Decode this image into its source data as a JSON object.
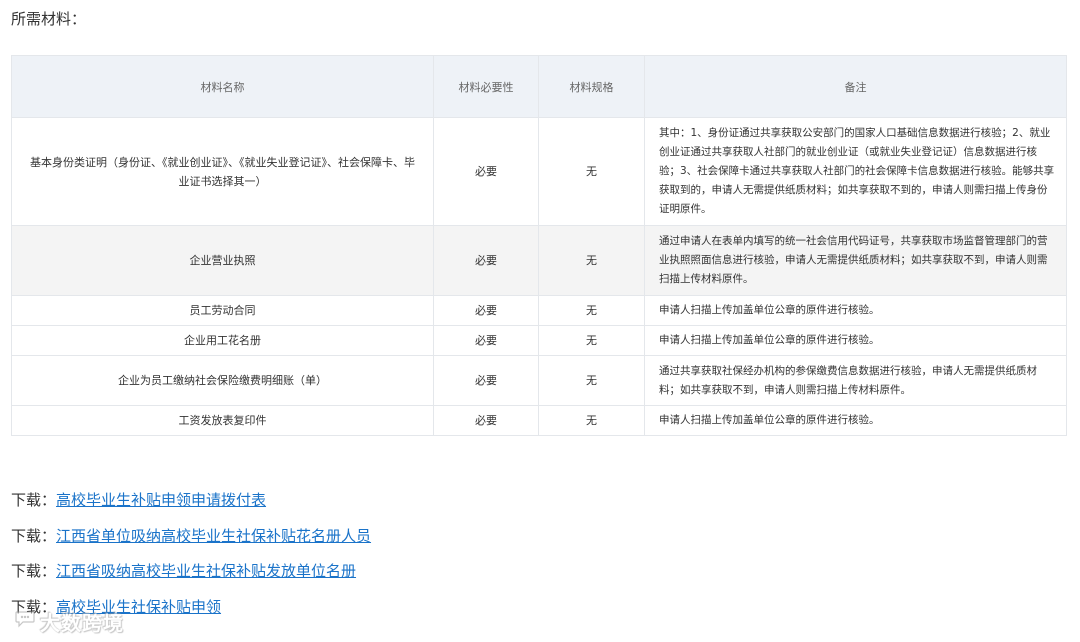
{
  "section": {
    "title": "所需材料："
  },
  "table": {
    "headers": [
      "材料名称",
      "材料必要性",
      "材料规格",
      "备注"
    ],
    "rows": [
      {
        "name": "基本身份类证明（身份证、《就业创业证》、《就业失业登记证》、社会保障卡、毕业证书选择其一）",
        "necessity": "必要",
        "spec": "无",
        "note": "其中：1、身份证通过共享获取公安部门的国家人口基础信息数据进行核验；2、就业创业证通过共享获取人社部门的就业创业证（或就业失业登记证）信息数据进行核验；3、社会保障卡通过共享获取人社部门的社会保障卡信息数据进行核验。能够共享获取到的，申请人无需提供纸质材料；如共享获取不到的，申请人则需扫描上传身份证明原件。"
      },
      {
        "name": "企业营业执照",
        "necessity": "必要",
        "spec": "无",
        "note": "通过申请人在表单内填写的统一社会信用代码证号，共享获取市场监督管理部门的营业执照照面信息进行核验，申请人无需提供纸质材料；如共享获取不到，申请人则需扫描上传材料原件。"
      },
      {
        "name": "员工劳动合同",
        "necessity": "必要",
        "spec": "无",
        "note": "申请人扫描上传加盖单位公章的原件进行核验。"
      },
      {
        "name": "企业用工花名册",
        "necessity": "必要",
        "spec": "无",
        "note": "申请人扫描上传加盖单位公章的原件进行核验。"
      },
      {
        "name": "企业为员工缴纳社会保险缴费明细账（单）",
        "necessity": "必要",
        "spec": "无",
        "note": "通过共享获取社保经办机构的参保缴费信息数据进行核验，申请人无需提供纸质材料；如共享获取不到，申请人则需扫描上传材料原件。"
      },
      {
        "name": "工资发放表复印件",
        "necessity": "必要",
        "spec": "无",
        "note": "申请人扫描上传加盖单位公章的原件进行核验。"
      }
    ]
  },
  "downloads": [
    {
      "prefix": "下载：",
      "label": "高校毕业生补贴申领申请拨付表"
    },
    {
      "prefix": "下载：",
      "label": "江西省单位吸纳高校毕业生社保补贴花名册人员"
    },
    {
      "prefix": "下载：",
      "label": "江西省吸纳高校毕业生社保补贴发放单位名册"
    },
    {
      "prefix": "下载：",
      "label": "高校毕业生社保补贴申领"
    }
  ],
  "watermark": {
    "text": "大数跨境",
    "icon": "chat-bubble-icon"
  },
  "colors": {
    "link": "#1a73c9",
    "header_bg": "#eef2f7",
    "alt_row_bg": "#f4f4f4",
    "border": "#e4e7eb"
  }
}
